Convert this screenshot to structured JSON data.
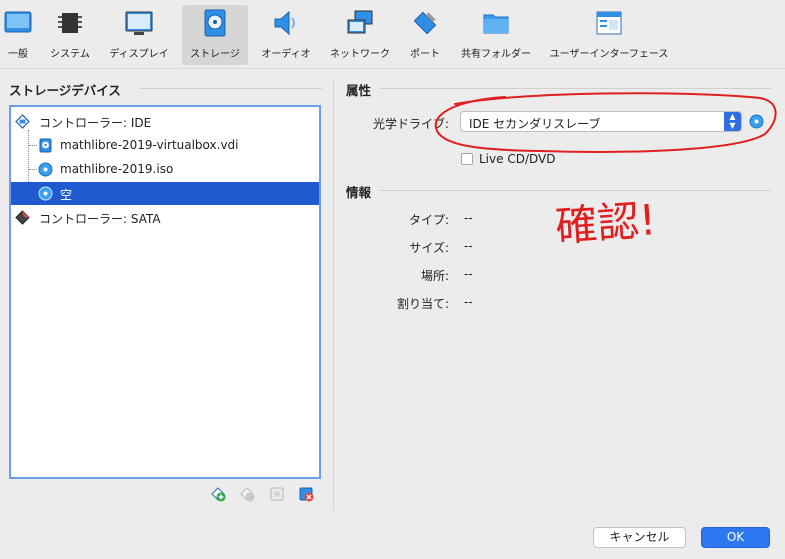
{
  "toolbar": {
    "items": [
      {
        "label": "一般",
        "icon": "general-icon"
      },
      {
        "label": "システム",
        "icon": "chip-icon"
      },
      {
        "label": "ディスプレイ",
        "icon": "display-icon"
      },
      {
        "label": "ストレージ",
        "icon": "storage-icon"
      },
      {
        "label": "オーディオ",
        "icon": "speaker-icon"
      },
      {
        "label": "ネットワーク",
        "icon": "network-icon"
      },
      {
        "label": "ポート",
        "icon": "port-icon"
      },
      {
        "label": "共有フォルダー",
        "icon": "folder-icon"
      },
      {
        "label": "ユーザーインターフェース",
        "icon": "window-icon"
      }
    ],
    "active": "ストレージ"
  },
  "storage": {
    "title": "ストレージデバイス",
    "tree": [
      {
        "label": "コントローラー: IDE",
        "icon": "ide-controller-icon"
      },
      {
        "label": "mathlibre-2019-virtualbox.vdi",
        "icon": "hard-disk-icon"
      },
      {
        "label": "mathlibre-2019.iso",
        "icon": "optical-disc-icon"
      },
      {
        "label": "空",
        "icon": "optical-disc-icon"
      },
      {
        "label": "コントローラー: SATA",
        "icon": "sata-controller-icon"
      }
    ],
    "selected": "空"
  },
  "attributes": {
    "title": "属性",
    "optical_drive_label": "光学ドライブ:",
    "optical_drive_value": "IDE セカンダリスレーブ",
    "live_cd_label": "Live CD/DVD"
  },
  "info": {
    "title": "情報",
    "rows": [
      {
        "label": "タイプ:",
        "value": "--"
      },
      {
        "label": "サイズ:",
        "value": "--"
      },
      {
        "label": "場所:",
        "value": "--"
      },
      {
        "label": "割り当て:",
        "value": "--"
      }
    ]
  },
  "annotation": {
    "text": "確認!",
    "color": "#e02020"
  },
  "buttons": {
    "cancel": "キャンセル",
    "ok": "OK"
  },
  "colors": {
    "accent": "#2b78f0",
    "selection": "#1f5ad1"
  }
}
